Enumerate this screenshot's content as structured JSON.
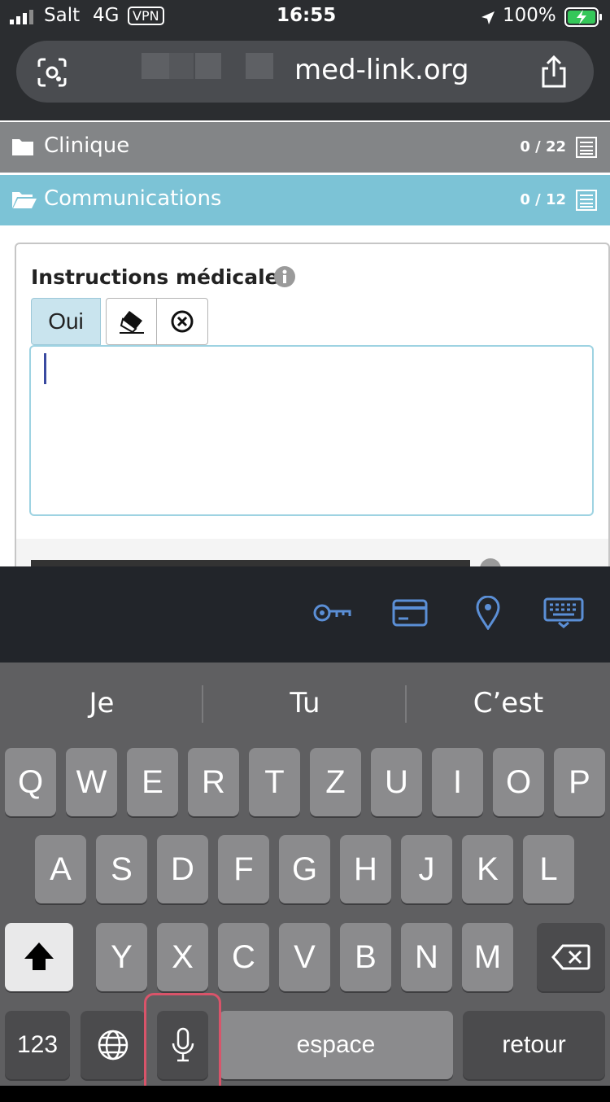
{
  "status": {
    "carrier": "Salt",
    "network": "4G",
    "vpn": "VPN",
    "time": "16:55",
    "battery": "100%"
  },
  "browser": {
    "url": "med-link.org"
  },
  "sections": [
    {
      "label": "Clinique",
      "count": "0 / 22",
      "color": "#838587"
    },
    {
      "label": "Communications",
      "count": "0 / 12",
      "color": "#7cc3d6"
    }
  ],
  "card": {
    "title": "Instructions médicales",
    "oui_button": "Oui",
    "textarea_value": ""
  },
  "keyboard": {
    "suggestions": [
      "Je",
      "Tu",
      "C’est"
    ],
    "row1": [
      "Q",
      "W",
      "E",
      "R",
      "T",
      "Z",
      "U",
      "I",
      "O",
      "P"
    ],
    "row2": [
      "A",
      "S",
      "D",
      "F",
      "G",
      "H",
      "J",
      "K",
      "L"
    ],
    "row3": [
      "Y",
      "X",
      "C",
      "V",
      "B",
      "N",
      "M"
    ],
    "numbers_key": "123",
    "space_key": "espace",
    "return_key": "retour"
  },
  "colors": {
    "accent_blue": "#7cc3d6",
    "icon_blue": "#5b8fd6",
    "highlight": "#d9546a"
  }
}
